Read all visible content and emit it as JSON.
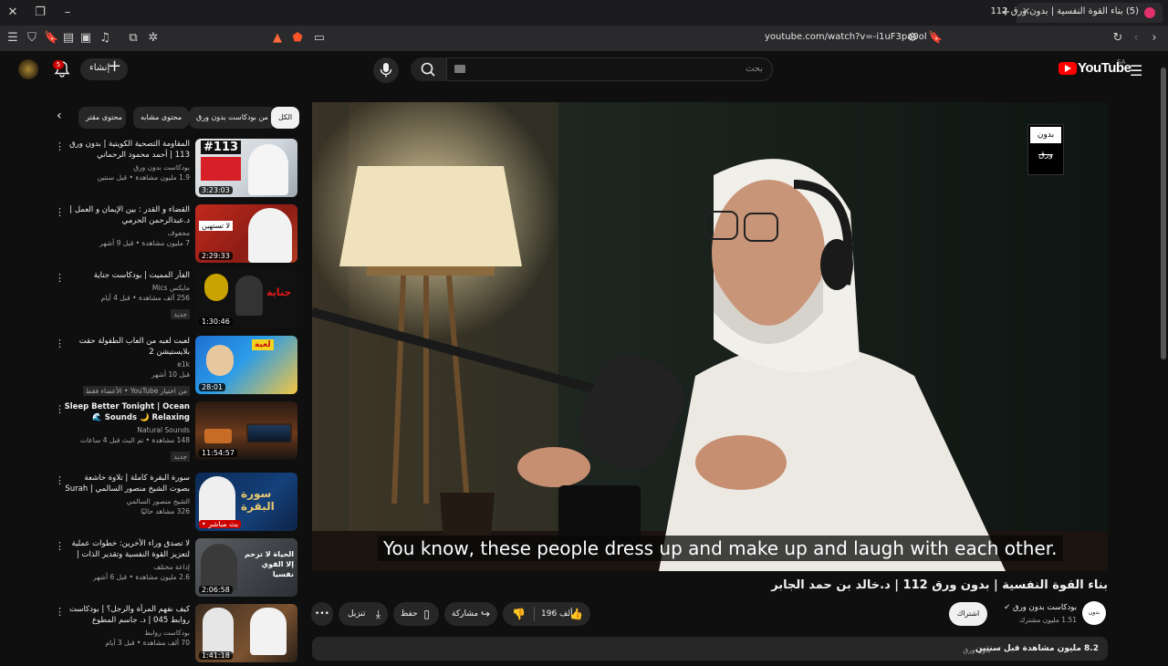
{
  "browser": {
    "tab_title": "(5) بناء القوة النفسية | بدون ورق 112",
    "url": "youtube.com/watch?v=-i1uF3pa0ol"
  },
  "header": {
    "logo_text": "YouTube",
    "region": "SA",
    "search_placeholder": "بحث",
    "create_label": "إنشاء",
    "notifications_count": "5"
  },
  "chips": [
    "الكل",
    "من بودكاست بدون ورق",
    "محتوى مشابه",
    "محتوى مقتر"
  ],
  "videos": [
    {
      "title": "المقاومة التصحية الكويتية | بدون ورق 113 | أحمد محمود الرحماني",
      "channel": "بودكاست بدون ورق",
      "stats": "1.9 مليون مشاهدة • قبل سنتين",
      "duration": "3:23:03",
      "thumb_text": "#113"
    },
    {
      "title": "القضاء و القدر : بين الإيمان و العمل | د.عبدالرحمن الحرمي",
      "channel": "محفوف",
      "stats": "7 مليون مشاهدة • قبل 9 أشهر",
      "duration": "2:29:33",
      "thumb_text": "لا تستهين"
    },
    {
      "title": "الفأر المميت | بودكاست جناية",
      "channel": "مايكس Mics",
      "stats": "256 ألف مشاهدة • قبل 4 أيام",
      "badge": "جديد",
      "duration": "1:30:46",
      "thumb_text": "جناية"
    },
    {
      "title": "لعبت لعبه من العاب الطفولة حقت بلايستيشن 2",
      "channel": "e1k",
      "stats": "قبل 10 أشهر",
      "badge": "من اختيار YouTube • الأعضاء فقط",
      "duration": "28:01",
      "thumb_text": "لعبة"
    },
    {
      "title": "Sleep Better Tonight | Ocean Sounds 🌙 Relaxing 🌊",
      "channel": "Natural Sounds",
      "stats": "148 مشاهدة • تم البث قبل 4 ساعات",
      "badge": "جديد",
      "duration": "11:54:57",
      "thumb_text": ""
    },
    {
      "title": "سورة البقرة كاملة | تلاوة خاشعة بصوت الشيخ منصور السالمي | Surah Al-Baqarah...",
      "channel": "الشيخ منصور السالمي",
      "stats": "326 مشاهد حاليًا",
      "duration": "• بث مباشر",
      "thumb_text": "سورة البقرة"
    },
    {
      "title": "لا تصدق وراء الآخرين: خطوات عملية لتعزيز القوة النفسية وتقدير الذات | بودكاست بلا ورق",
      "channel": "إذاعة مختلف",
      "stats": "2.6 مليون مشاهدة • قبل 6 أشهر",
      "duration": "2:06:58",
      "thumb_text": "الحياة لا ترحم إلا القوي نفسيا"
    },
    {
      "title": "كيف نفهم المرأة والرجل؟ | بودكاست روابط 045 | د. جاسم المطوع",
      "channel": "بودكاست روابط",
      "stats": "70 ألف مشاهدة • قبل 3 أيام",
      "duration": "1:41:18",
      "thumb_text": ""
    }
  ],
  "player": {
    "caption": "You know, these people dress up and make up and laugh with each other.",
    "brand_line1": "بدون",
    "brand_line2": "ورق"
  },
  "video": {
    "title": "بناء القوة النفسية | بدون ورق 112 | د.خالد بن حمد الجابر",
    "channel": "بودكاست بدون ورق",
    "subscribers": "1.51 مليون مشترك",
    "subscribe_label": "اشتراك",
    "likes": "196 ألف",
    "share_label": "مشاركة",
    "save_label": "حفظ",
    "download_label": "تنزيل",
    "views": "8.2 مليون مشاهدة  قبل سنتين",
    "tag": "بدون ورق"
  },
  "colors": {
    "accent": "#ff0000",
    "bg": "#0f0f0f",
    "chip": "#272727"
  }
}
